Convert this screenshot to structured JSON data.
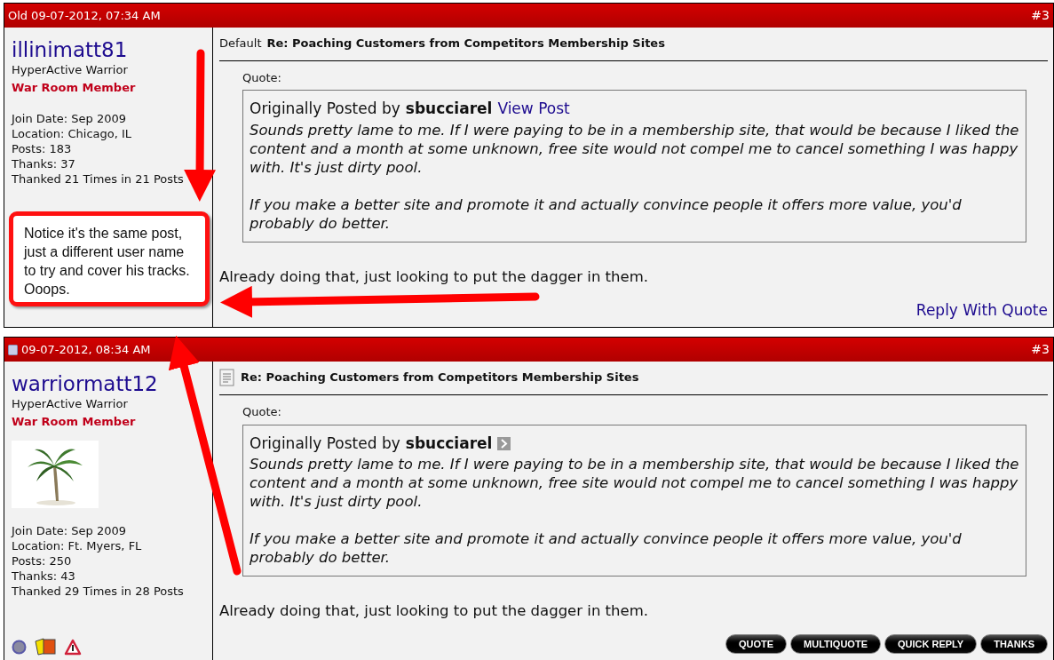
{
  "posts": [
    {
      "status_label": "Old",
      "date": "09-07-2012, 07:34 AM",
      "post_number": "#3",
      "username": "illinimatt81",
      "user_title": "HyperActive Warrior",
      "rank": "War Room Member",
      "stats": [
        "Join Date: Sep 2009",
        "Location: Chicago, IL",
        "Posts: 183",
        "Thanks: 37",
        "Thanked 21 Times in 21 Posts"
      ],
      "title_prefix": "Default",
      "title": "Re: Poaching Customers from Competitors Membership Sites",
      "quote": {
        "label": "Quote:",
        "posted_by": "Originally Posted by",
        "author": "sbucciarel",
        "view_link": "View Post",
        "paragraphs": [
          "Sounds pretty lame to me. If I were paying to be in a membership site, that would be because I liked the content and a month at some unknown, free site would not compel me to cancel something I was happy with. It's just dirty pool.",
          "If you make a better site and promote it and actually convince people it offers more value, you'd probably do better."
        ]
      },
      "message": "Already doing that, just looking to put the dagger in them.",
      "reply_link": "Reply With Quote"
    },
    {
      "date": "09-07-2012, 08:34 AM",
      "post_number": "#3",
      "username": "warriormatt12",
      "user_title": "HyperActive Warrior",
      "rank": "War Room Member",
      "avatar": {
        "kind": "picture"
      },
      "stats": [
        "Join Date: Sep 2009",
        "Location: Ft. Myers, FL",
        "Posts: 250",
        "Thanks: 43",
        "Thanked 29 Times in 28 Posts"
      ],
      "title": "Re: Poaching Customers from Competitors Membership Sites",
      "quote": {
        "label": "Quote:",
        "posted_by": "Originally Posted by",
        "author": "sbucciarel",
        "paragraphs": [
          "Sounds pretty lame to me. If I were paying to be in a membership site, that would be because I liked the content and a month at some unknown, free site would not compel me to cancel something I was happy with. It's just dirty pool.",
          "If you make a better site and promote it and actually convince people it offers more value, you'd probably do better."
        ]
      },
      "message": "Already doing that, just looking to put the dagger in them.",
      "buttons": [
        "QUOTE",
        "MULTIQUOTE",
        "QUICK REPLY",
        "THANKS"
      ]
    }
  ],
  "annotation": {
    "callout": "Notice it's the same post, just a different user name to try and cover his tracks. Ooops."
  }
}
